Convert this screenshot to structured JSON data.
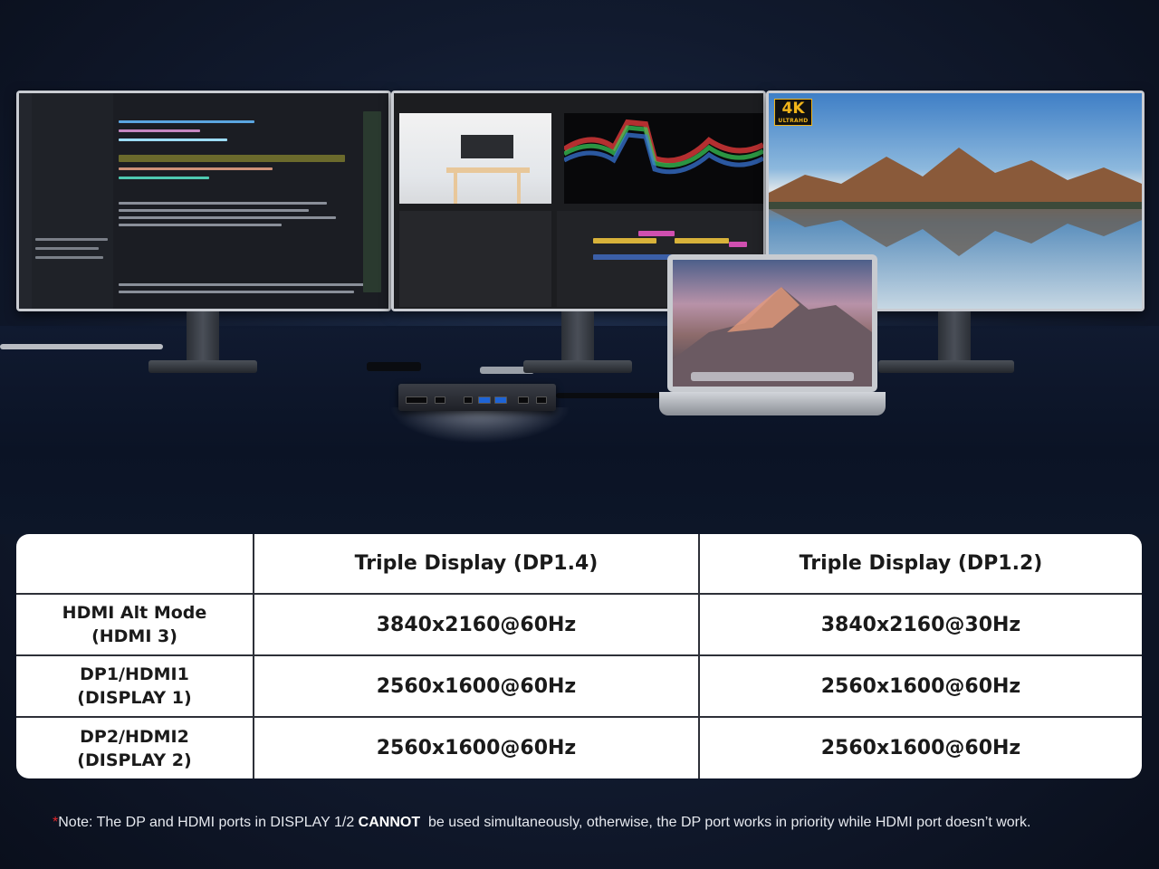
{
  "scene": {
    "badge": {
      "main": "4K",
      "sub": "ULTRAHD"
    }
  },
  "table": {
    "headers": [
      "",
      "Triple Display (DP1.4)",
      "Triple Display (DP1.2)"
    ],
    "rows": [
      {
        "label": "HDMI Alt Mode\n(HDMI 3)",
        "dp14": "3840x2160@60Hz",
        "dp12": "3840x2160@30Hz"
      },
      {
        "label": "DP1/HDMI1\n(DISPLAY 1)",
        "dp14": "2560x1600@60Hz",
        "dp12": "2560x1600@60Hz"
      },
      {
        "label": "DP2/HDMI2\n(DISPLAY 2)",
        "dp14": "2560x1600@60Hz",
        "dp12": "2560x1600@60Hz"
      }
    ]
  },
  "note": {
    "marker": "*",
    "prefix": "Note: The DP and HDMI ports in DISPLAY 1/2 ",
    "emphasis": "CANNOT",
    "suffix": "  be used simultaneously, otherwise, the DP port works in priority while HDMI port doesn’t work."
  },
  "colors": {
    "note_marker": "#e2262b",
    "badge_text": "#f0b41a"
  }
}
